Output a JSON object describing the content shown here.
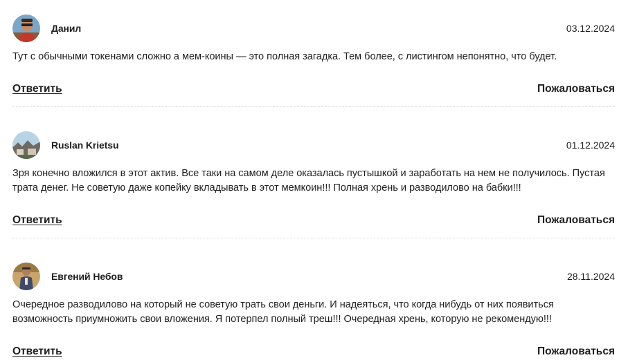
{
  "comments": [
    {
      "author": "Данил",
      "date": "03.12.2024",
      "text": "Тут с обычными токенами сложно а мем-коины — это полная загадка. Тем более, с листингом непонятно, что будет.",
      "reply_label": "Ответить",
      "report_label": "Пожаловаться",
      "avatar_icon": "user-photo-avatar"
    },
    {
      "author": "Ruslan Krietsu",
      "date": "01.12.2024",
      "text": "Зря конечно вложился в этот актив. Все таки на самом деле оказалась пустышкой и заработать на нем не получилось. Пустая трата денег. Не советую даже копейку вкладывать в этот мемкоин!!! Полная хрень и разводилово на бабки!!!",
      "reply_label": "Ответить",
      "report_label": "Пожаловаться",
      "avatar_icon": "landscape-photo-avatar"
    },
    {
      "author": "Евгений Небов",
      "date": "28.11.2024",
      "text": "Очередное разводилово на который не советую трать свои деньги. И надеяться, что когда нибудь от них появиться возможность приумножить свои вложения. Я потерпел полный треш!!! Очередная хрень, которую не рекомендую!!!",
      "reply_label": "Ответить",
      "report_label": "Пожаловаться",
      "avatar_icon": "user-photo-avatar"
    }
  ]
}
